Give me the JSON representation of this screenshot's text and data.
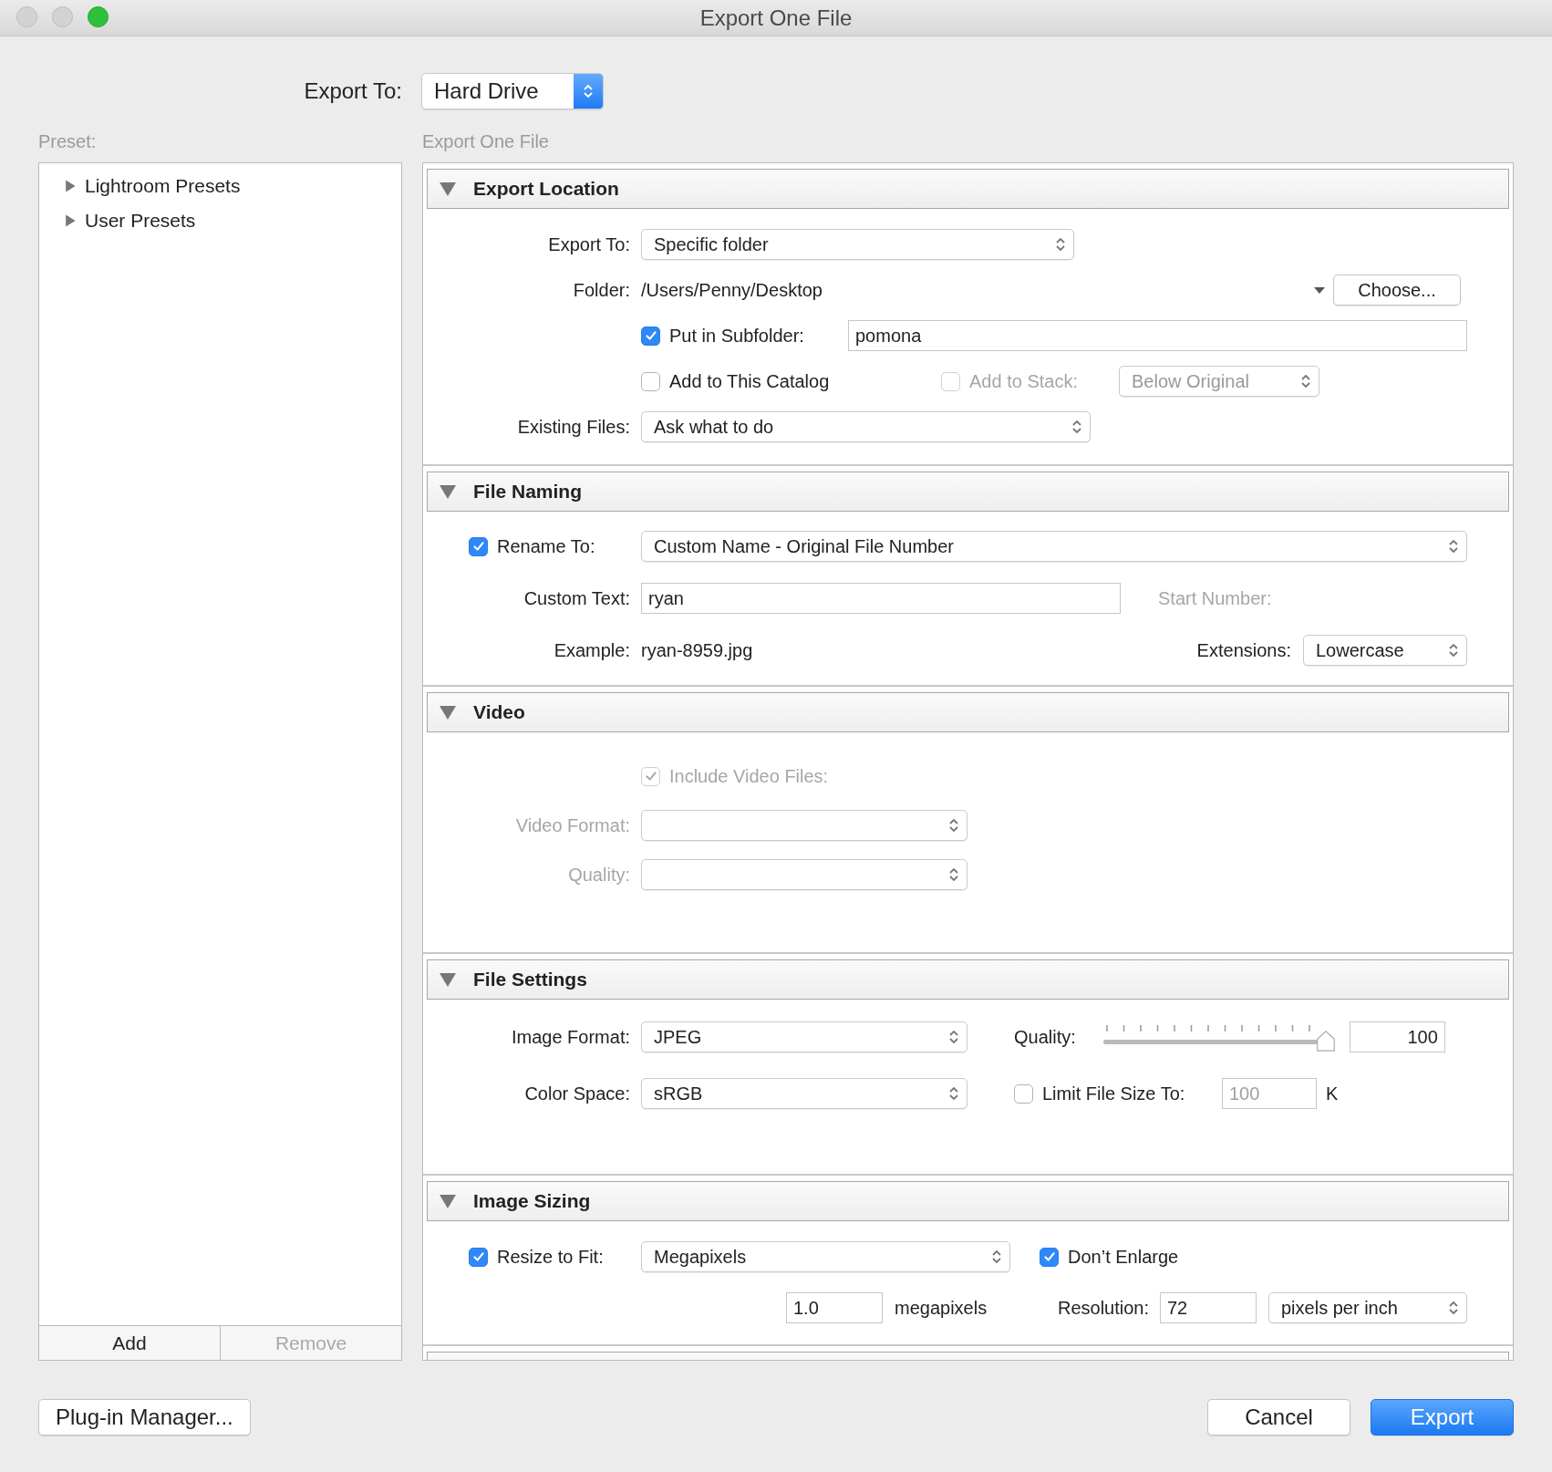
{
  "window": {
    "title": "Export One File"
  },
  "export_to": {
    "label": "Export To:",
    "value": "Hard Drive"
  },
  "preset": {
    "label": "Preset:",
    "items": [
      {
        "label": "Lightroom Presets",
        "expanded": false
      },
      {
        "label": "User Presets",
        "expanded": false
      }
    ],
    "add_button": "Add",
    "remove_button": {
      "label": "Remove",
      "disabled": true
    }
  },
  "settings_title": "Export One File",
  "export_location": {
    "title": "Export Location",
    "expanded": true,
    "export_to": {
      "label": "Export To:",
      "value": "Specific folder"
    },
    "folder": {
      "label": "Folder:",
      "value": "/Users/Penny/Desktop"
    },
    "choose_button": "Choose...",
    "subfolder": {
      "label": "Put in Subfolder:",
      "checked": true,
      "value": "pomona"
    },
    "add_to_catalog": {
      "label": "Add to This Catalog",
      "checked": false
    },
    "add_to_stack": {
      "label": "Add to Stack:",
      "checked": false,
      "disabled": true,
      "value": "Below Original"
    },
    "existing_files": {
      "label": "Existing Files:",
      "value": "Ask what to do"
    }
  },
  "file_naming": {
    "title": "File Naming",
    "expanded": true,
    "rename": {
      "label": "Rename To:",
      "checked": true,
      "value": "Custom Name - Original File Number"
    },
    "custom_text": {
      "label": "Custom Text:",
      "value": "ryan"
    },
    "start_number": {
      "label": "Start Number:",
      "disabled": true
    },
    "example": {
      "label": "Example:",
      "value": "ryan-8959.jpg"
    },
    "extensions": {
      "label": "Extensions:",
      "value": "Lowercase"
    }
  },
  "video": {
    "title": "Video",
    "expanded": true,
    "include": {
      "label": "Include Video Files:",
      "checked": true,
      "disabled": true
    },
    "video_format": {
      "label": "Video Format:",
      "disabled": true
    },
    "quality": {
      "label": "Quality:",
      "disabled": true
    }
  },
  "file_settings": {
    "title": "File Settings",
    "expanded": true,
    "image_format": {
      "label": "Image Format:",
      "value": "JPEG"
    },
    "quality": {
      "label": "Quality:",
      "level": 1.0,
      "value": "100"
    },
    "color_space": {
      "label": "Color Space:",
      "value": "sRGB"
    },
    "limit": {
      "label": "Limit File Size To:",
      "checked": false,
      "value": "100",
      "unit": "K"
    }
  },
  "image_sizing": {
    "title": "Image Sizing",
    "expanded": true,
    "resize": {
      "label": "Resize to Fit:",
      "checked": true,
      "value": "Megapixels"
    },
    "dont_enlarge": {
      "label": "Don’t Enlarge",
      "checked": true
    },
    "megapixels": {
      "value": "1.0",
      "unit": "megapixels"
    },
    "resolution": {
      "label": "Resolution:",
      "value": "72",
      "unit": "pixels per inch"
    }
  },
  "buttons": {
    "plugin_manager": "Plug-in Manager...",
    "cancel": "Cancel",
    "export": "Export"
  }
}
